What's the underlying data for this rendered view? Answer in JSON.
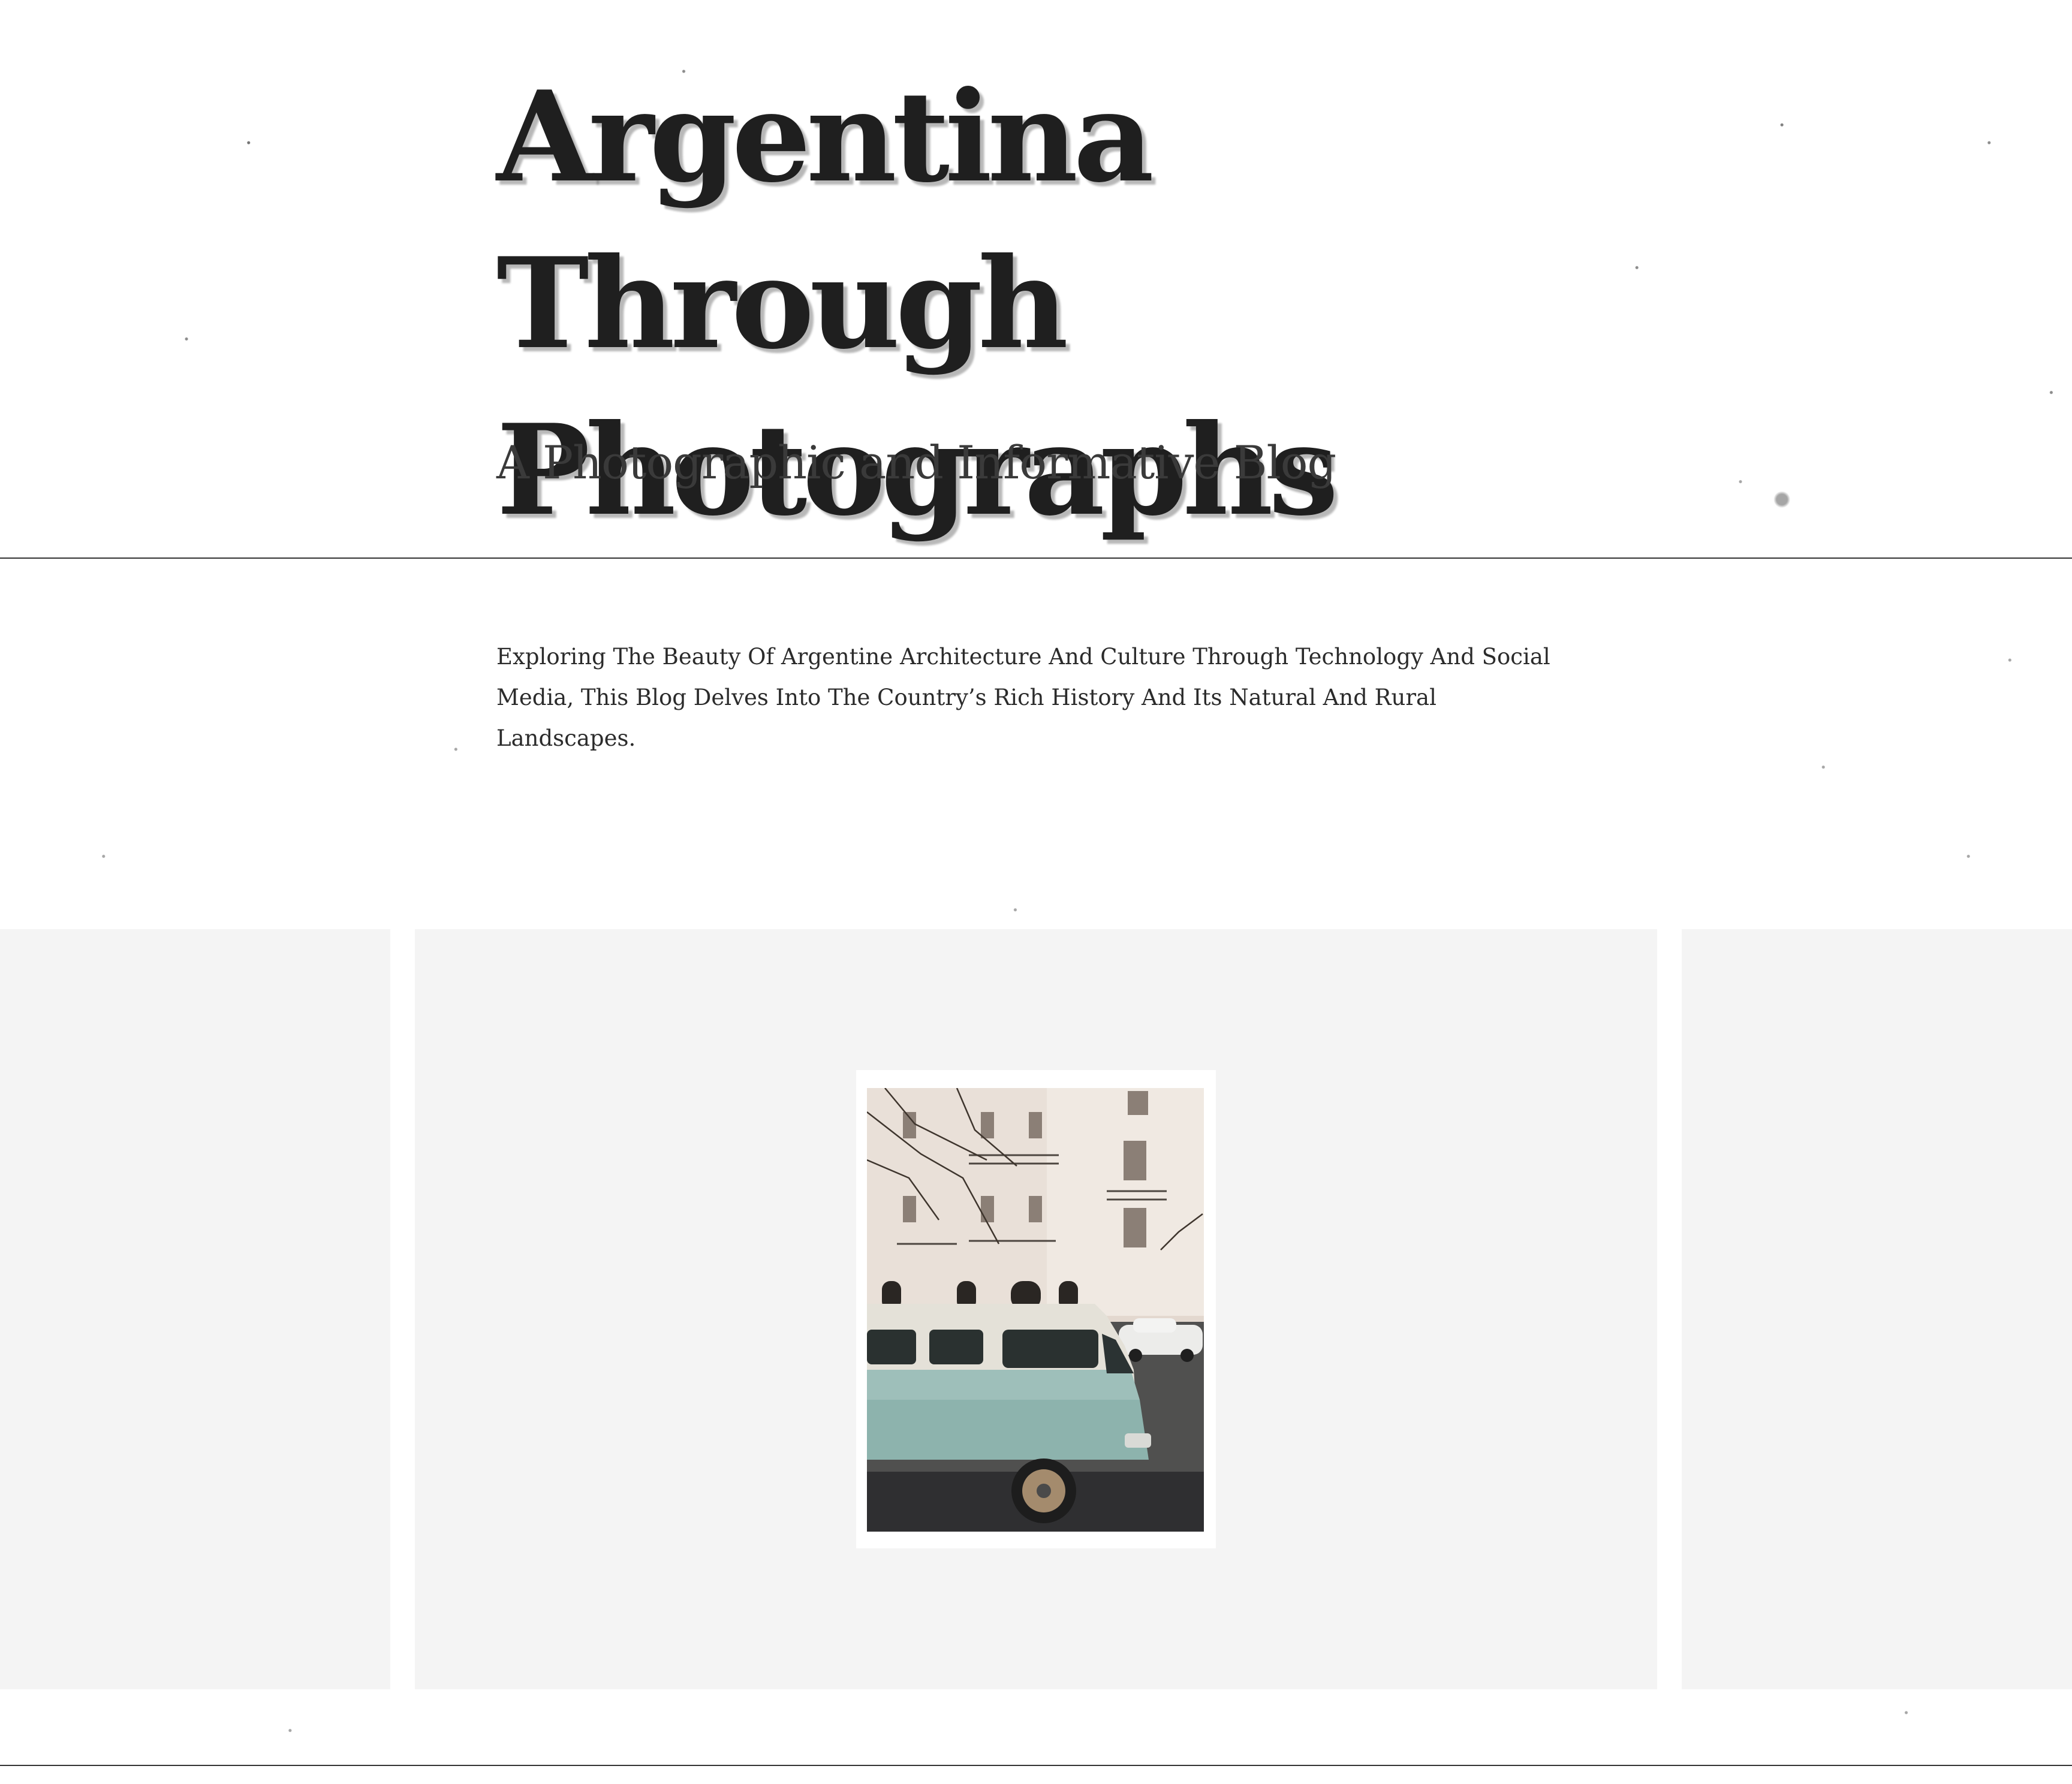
{
  "header": {
    "title": "Argentina Through Photographs",
    "subtitle": "A Photographic and Informative Blog"
  },
  "intro": {
    "text": "Exploring The Beauty Of Argentine Architecture And Culture Through Technology And Social Media, This Blog Delves Into The Country’s Rich History And Its Natural And Rural Landscapes."
  },
  "colors": {
    "background": "#ffffff",
    "title_text": "#1f1f1f",
    "rule": "#333333",
    "slide_background": "#f4f4f4",
    "photo_frame": "#ffffff"
  },
  "carousel": {
    "current_photo": {
      "subject": "vintage teal-and-white van parked in front of a classical building"
    }
  }
}
